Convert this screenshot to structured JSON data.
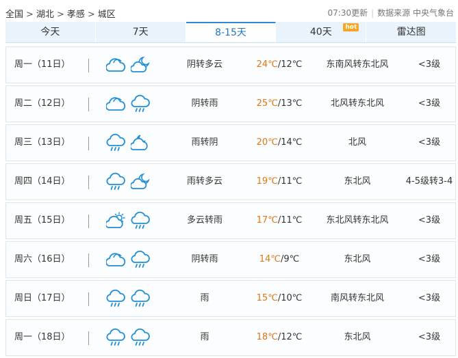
{
  "breadcrumb": {
    "items": [
      "全国",
      "湖北",
      "孝感",
      "城区"
    ],
    "separator": ">"
  },
  "meta": {
    "update_time": "07:30更新",
    "source": "数据来源 中央气象台"
  },
  "tabs": [
    {
      "label": "今天",
      "active": false
    },
    {
      "label": "7天",
      "active": false
    },
    {
      "label": "8-15天",
      "active": true
    },
    {
      "label": "40天",
      "active": false,
      "badge": "hot"
    },
    {
      "label": "雷达图",
      "active": false
    }
  ],
  "colors": {
    "accent": "#1c78c6",
    "high_temp": "#e07615",
    "tab_bg": "#e8f3fb",
    "badge": "#f5a623",
    "icon_stroke": "#1f8fd6"
  },
  "forecast": [
    {
      "day": "周一（11日）",
      "icons": [
        "cloudy-icon",
        "partly-cloudy-night-icon"
      ],
      "desc": "阴转多云",
      "high": "24℃",
      "low": "/12℃",
      "wind": "东南风转东北风",
      "level": "<3级"
    },
    {
      "day": "周二（12日）",
      "icons": [
        "cloudy-icon",
        "rain-icon"
      ],
      "desc": "阴转雨",
      "high": "25℃",
      "low": "/13℃",
      "wind": "北风转东北风",
      "level": "<3级"
    },
    {
      "day": "周三（13日）",
      "icons": [
        "rain-icon",
        "cloudy-night-icon"
      ],
      "desc": "雨转阴",
      "high": "20℃",
      "low": "/14℃",
      "wind": "北风",
      "level": "<3级"
    },
    {
      "day": "周四（14日）",
      "icons": [
        "rain-icon",
        "partly-cloudy-night-icon"
      ],
      "desc": "雨转多云",
      "high": "19℃",
      "low": "/11℃",
      "wind": "东北风",
      "level": "4-5级转3-4"
    },
    {
      "day": "周五（15日）",
      "icons": [
        "partly-cloudy-day-icon",
        "rain-icon"
      ],
      "desc": "多云转雨",
      "high": "17℃",
      "low": "/11℃",
      "wind": "东北风转东北风",
      "level": "<3级"
    },
    {
      "day": "周六（16日）",
      "icons": [
        "cloudy-icon",
        "rain-icon"
      ],
      "desc": "阴转雨",
      "high": "14℃",
      "low": "/9℃",
      "wind": "东北风",
      "level": "<3级"
    },
    {
      "day": "周日（17日）",
      "icons": [
        "rain-icon",
        "rain-icon"
      ],
      "desc": "雨",
      "high": "15℃",
      "low": "/10℃",
      "wind": "南风转东北风",
      "level": "<3级"
    },
    {
      "day": "周一（18日）",
      "icons": [
        "rain-icon",
        "rain-icon"
      ],
      "desc": "雨",
      "high": "18℃",
      "low": "/12℃",
      "wind": "东北风",
      "level": "<3级"
    }
  ]
}
